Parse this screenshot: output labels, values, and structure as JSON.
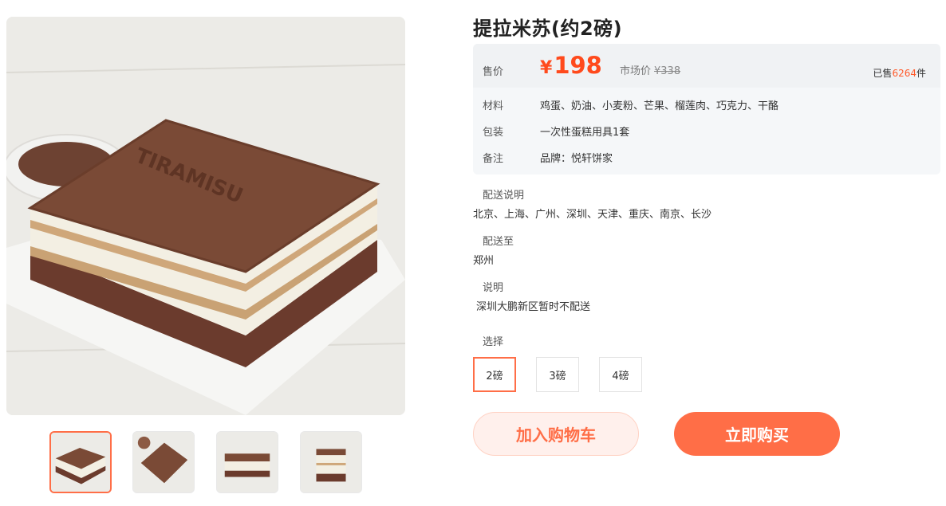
{
  "product": {
    "title": "提拉米苏(约2磅)",
    "price_label": "售价",
    "price_symbol": "¥",
    "price": "198",
    "market_label": "市场价",
    "market_price": "¥338",
    "sold_prefix": "已售",
    "sold_count": "6264",
    "sold_suffix": "件",
    "attributes": [
      {
        "key": "材料",
        "value": "鸡蛋、奶油、小麦粉、芒果、榴莲肉、巧克力、干酪"
      },
      {
        "key": "包装",
        "value": "一次性蛋糕用具1套"
      },
      {
        "key": "备注",
        "value": "品牌：悦轩饼家"
      }
    ]
  },
  "delivery": {
    "scope_label": "配送说明",
    "scope_value": "北京、上海、广州、深圳、天津、重庆、南京、长沙",
    "to_label": "配送至",
    "to_value": "郑州",
    "note_label": "说明",
    "note_value": "深圳大鹏新区暂时不配送"
  },
  "selection": {
    "label": "选择",
    "options": [
      "2磅",
      "3磅",
      "4磅"
    ],
    "selected": "2磅"
  },
  "actions": {
    "add_to_cart": "加入购物车",
    "buy_now": "立即购买"
  },
  "gallery": {
    "main_image": "tiramisu-cake-photo",
    "thumbnails": [
      "tiramisu-side-view",
      "tiramisu-top-view",
      "tiramisu-front-view",
      "tiramisu-slice-view"
    ],
    "active_thumbnail": 0
  },
  "colors": {
    "accent": "#ff6e47",
    "price": "#ff4a1c",
    "panel_bg": "#f5f7f9"
  }
}
